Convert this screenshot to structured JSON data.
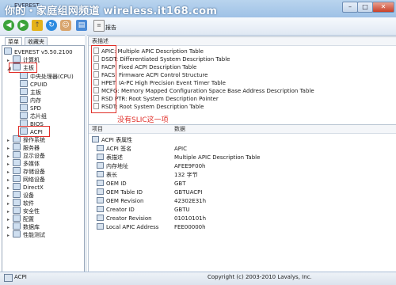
{
  "window": {
    "title": "EVEREST",
    "watermark": "你的・家庭组网频道 wireless.it168.com",
    "min_glyph": "–",
    "max_glyph": "□",
    "close_glyph": "✕"
  },
  "toolbar": {
    "back_glyph": "◀",
    "forward_glyph": "▶",
    "up_glyph": "↑",
    "refresh_glyph": "↻",
    "user_glyph": "☺",
    "chart_glyph": "▤",
    "report_glyph": "≡",
    "report_label": "报告"
  },
  "tabs": {
    "menu": "菜单",
    "favorites": "收藏夹"
  },
  "tree": {
    "root": "EVEREST v5.50.2100",
    "computer": "计算机",
    "motherboard": "主板",
    "cpu_full": "中央处理器(CPU)",
    "cpuid": "CPUID",
    "mb": "主板",
    "memory": "内存",
    "spd": "SPD",
    "chipset": "芯片组",
    "bios": "BIOS",
    "acpi": "ACPI",
    "os": "操作系统",
    "server": "服务器",
    "display": "显示设备",
    "multimedia": "多媒体",
    "storage": "存储设备",
    "network": "网络设备",
    "directx": "DirectX",
    "devices": "设备",
    "software": "软件",
    "security": "安全性",
    "config": "配置",
    "database": "数据库",
    "benchmark": "性能测试"
  },
  "desc": {
    "header": "表描述",
    "rows": [
      "APIC: Multiple APIC Description Table",
      "DSDT: Differentiated System Description Table",
      "FACP: Fixed ACPI Description Table",
      "FACS: Firmware ACPI Control Structure",
      "HPET: IA-PC High Precision Event Timer Table",
      "MCFG: Memory Mapped Configuration Space Base Address Description Table",
      "RSD PTR: Root System Description Pointer",
      "RSDT: Root System Description Table"
    ],
    "annotation": "没有SLIC这一项"
  },
  "detail": {
    "col_item": "项目",
    "col_data": "数据",
    "group": "ACPI 表属性",
    "rows": [
      {
        "name": "ACPI 签名",
        "value": "APIC"
      },
      {
        "name": "表描述",
        "value": "Multiple APIC Description Table"
      },
      {
        "name": "内存地址",
        "value": "AFEE9F00h"
      },
      {
        "name": "表长",
        "value": "132 字节"
      },
      {
        "name": "OEM ID",
        "value": "GBT"
      },
      {
        "name": "OEM Table ID",
        "value": "GBTUACPI"
      },
      {
        "name": "OEM Revision",
        "value": "42302E31h"
      },
      {
        "name": "Creator ID",
        "value": "GBTU"
      },
      {
        "name": "Creator Revision",
        "value": "01010101h"
      },
      {
        "name": "Local APIC Address",
        "value": "FEE00000h"
      }
    ]
  },
  "status": {
    "left": "ACPI",
    "right": "Copyright (c) 2003-2010 Lavalys, Inc."
  },
  "colors": {
    "annotation": "#e0302a",
    "titlebar": "#9ec1e6"
  }
}
